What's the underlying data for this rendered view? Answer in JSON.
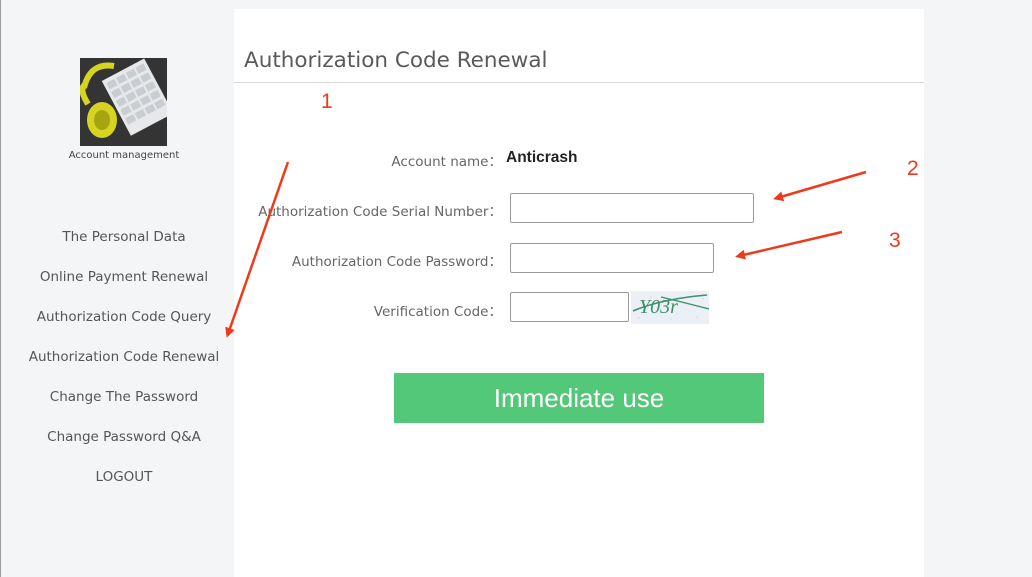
{
  "sidebar": {
    "avatar_caption": "Account management",
    "items": [
      {
        "label": "The Personal Data"
      },
      {
        "label": "Online Payment Renewal"
      },
      {
        "label": "Authorization Code Query"
      },
      {
        "label": "Authorization Code Renewal"
      },
      {
        "label": "Change The Password"
      },
      {
        "label": "Change Password Q&A"
      },
      {
        "label": "LOGOUT"
      }
    ]
  },
  "main": {
    "title": "Authorization Code Renewal",
    "form": {
      "account_label": "Account name：",
      "account_value": "Anticrash",
      "serial_label": "Authorization Code Serial Number：",
      "serial_value": "",
      "password_label": "Authorization Code Password：",
      "password_value": "",
      "verification_label": "Verification Code：",
      "verification_value": "",
      "captcha_text": "Y03r"
    },
    "submit_label": "Immediate use"
  },
  "annotations": {
    "marker_1": "1",
    "marker_2": "2",
    "marker_3": "3",
    "color": "#ee3a1a"
  },
  "colors": {
    "submit_button": "#52c878",
    "page_background": "#f4f5f7"
  }
}
